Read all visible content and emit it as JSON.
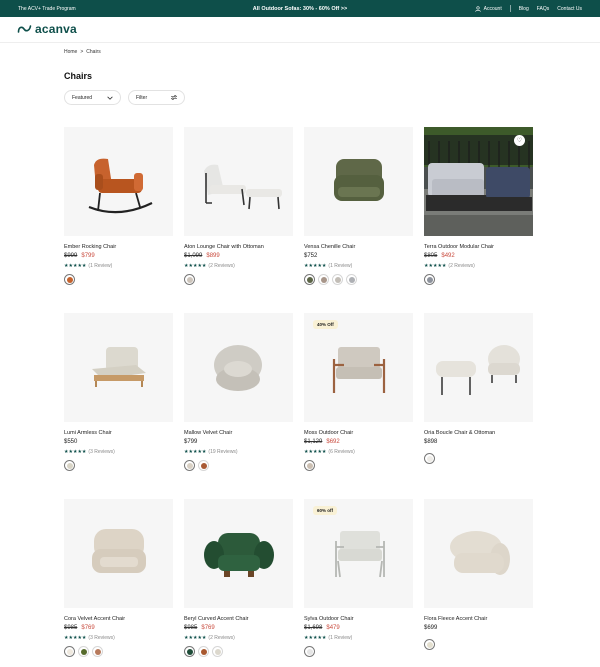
{
  "topbar": {
    "left": "The ACV+ Trade Program",
    "center": "All Outdoor Sofas: 30% - 60% Off >>",
    "account": "Account",
    "blog": "Blog",
    "faqs": "FAQs",
    "contact": "Contact Us"
  },
  "header": {
    "logo": "acanva"
  },
  "breadcrumb": {
    "home": "Home",
    "separator": ">",
    "current": "Chairs"
  },
  "page": {
    "title": "Chairs"
  },
  "controls": {
    "sort_label": "Featured",
    "filter_label": "Filter"
  },
  "products": [
    {
      "name": "Ember Rocking Chair",
      "price_original": "$999",
      "price_sale": "$799",
      "price_regular": "",
      "stars": "★★★★★",
      "reviews": "(1 Review)",
      "badge": "",
      "swatches": [
        "#c4622d"
      ]
    },
    {
      "name": "Aton Lounge Chair with Ottoman",
      "price_original": "$1,099",
      "price_sale": "$899",
      "price_regular": "",
      "stars": "★★★★★",
      "reviews": "(2 Reviews)",
      "badge": "",
      "swatches": [
        "#cdc5bc"
      ]
    },
    {
      "name": "Vensa Chenille Chair",
      "price_original": "",
      "price_sale": "",
      "price_regular": "$752",
      "stars": "★★★★★",
      "reviews": "(1 Review)",
      "badge": "",
      "swatches": [
        "#5b6446",
        "#a8968a",
        "#c2bdb6",
        "#aeb0b4"
      ]
    },
    {
      "name": "Terra Outdoor Modular Chair",
      "price_original": "$805",
      "price_sale": "$492",
      "price_regular": "",
      "stars": "★★★★★",
      "reviews": "(2 Reviews)",
      "badge": "",
      "swatches": [
        "#8d929c"
      ]
    },
    {
      "name": "Lumi Armless Chair",
      "price_original": "",
      "price_sale": "",
      "price_regular": "$550",
      "stars": "★★★★★",
      "reviews": "(3 Reviews)",
      "badge": "",
      "swatches": [
        "#d8d4c6"
      ]
    },
    {
      "name": "Mallow Velvet Chair",
      "price_original": "",
      "price_sale": "",
      "price_regular": "$799",
      "stars": "★★★★★",
      "reviews": "(19 Reviews)",
      "badge": "",
      "swatches": [
        "#d8d0c4",
        "#a85a35"
      ]
    },
    {
      "name": "Moss Outdoor Chair",
      "price_original": "$1,129",
      "price_sale": "$692",
      "price_regular": "",
      "stars": "★★★★★",
      "reviews": "(6 Reviews)",
      "badge": "40% Off",
      "swatches": [
        "#cbbfb2"
      ]
    },
    {
      "name": "Oria Boucle Chair & Ottoman",
      "price_original": "",
      "price_sale": "",
      "price_regular": "$898",
      "stars": "",
      "reviews": "",
      "badge": "",
      "swatches": [
        "#eeece8"
      ]
    },
    {
      "name": "Cora Velvet Accent Chair",
      "price_original": "$985",
      "price_sale": "$769",
      "price_regular": "",
      "stars": "★★★★★",
      "reviews": "(3 Reviews)",
      "badge": "",
      "swatches": [
        "#efe9df",
        "#566b2c",
        "#b77a5c"
      ]
    },
    {
      "name": "Beryl Curved Accent Chair",
      "price_original": "$985",
      "price_sale": "$769",
      "price_regular": "",
      "stars": "★★★★★",
      "reviews": "(2 Reviews)",
      "badge": "",
      "swatches": [
        "#1f4d39",
        "#a8582f",
        "#dcd8cd"
      ]
    },
    {
      "name": "Sylva Outdoor Chair",
      "price_original": "$1,698",
      "price_sale": "$479",
      "price_regular": "",
      "stars": "★★★★★",
      "reviews": "(1 Review)",
      "badge": "60% off",
      "swatches": [
        "#e5e5e5"
      ]
    },
    {
      "name": "Flora Fleece Accent Chair",
      "price_original": "",
      "price_sale": "",
      "price_regular": "$699",
      "stars": "",
      "reviews": "",
      "badge": "",
      "swatches": [
        "#e3dfcf"
      ]
    }
  ]
}
